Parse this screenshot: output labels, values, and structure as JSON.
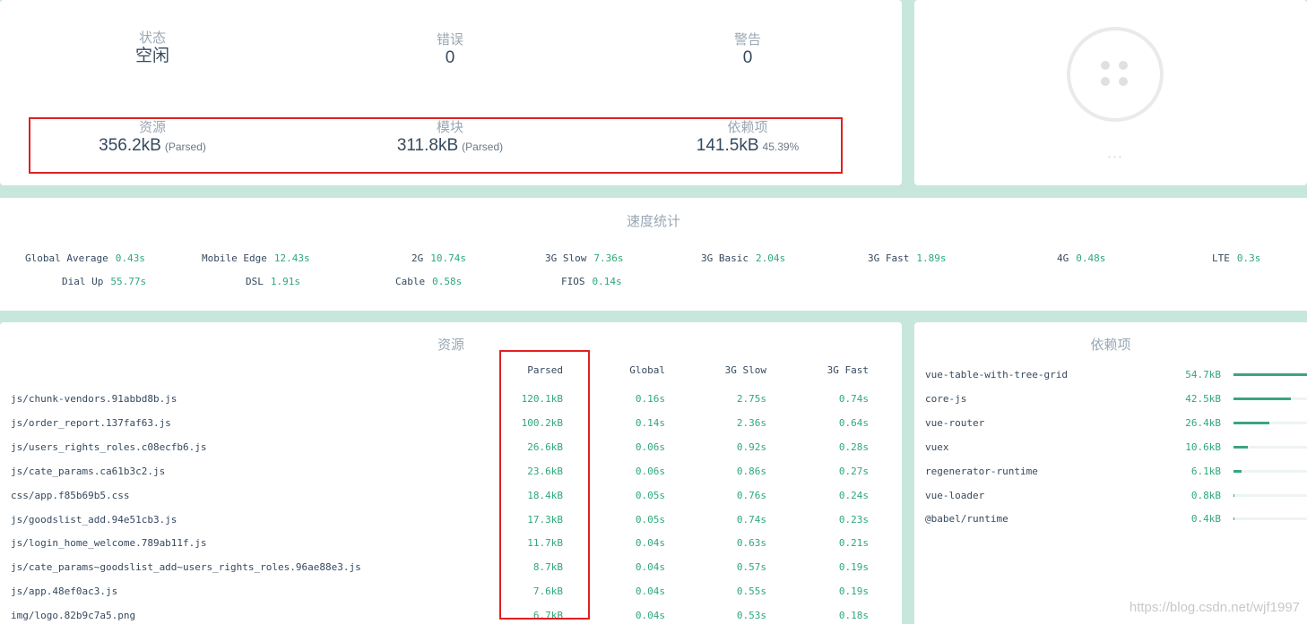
{
  "status": {
    "state": {
      "label": "状态",
      "value": "空闲"
    },
    "errors": {
      "label": "错误",
      "value": "0"
    },
    "warnings": {
      "label": "警告",
      "value": "0"
    },
    "assets": {
      "label": "资源",
      "value": "356.2kB",
      "sub": "(Parsed)"
    },
    "modules": {
      "label": "模块",
      "value": "311.8kB",
      "sub": "(Parsed)"
    },
    "dependencies": {
      "label": "依赖项",
      "value": "141.5kB",
      "sub": "45.39%"
    }
  },
  "logo": {
    "ellipsis": "···"
  },
  "speed": {
    "title": "速度统计",
    "items": [
      {
        "name": "Global Average",
        "value": "0.43s"
      },
      {
        "name": "Mobile Edge",
        "value": "12.43s"
      },
      {
        "name": "2G",
        "value": "10.74s"
      },
      {
        "name": "3G Slow",
        "value": "7.36s"
      },
      {
        "name": "3G Basic",
        "value": "2.04s"
      },
      {
        "name": "3G Fast",
        "value": "1.89s"
      },
      {
        "name": "4G",
        "value": "0.48s"
      },
      {
        "name": "LTE",
        "value": "0.3s"
      },
      {
        "name": "Dial Up",
        "value": "55.77s"
      },
      {
        "name": "DSL",
        "value": "1.91s"
      },
      {
        "name": "Cable",
        "value": "0.58s"
      },
      {
        "name": "FIOS",
        "value": "0.14s"
      }
    ]
  },
  "assets": {
    "title": "资源",
    "columns": [
      "Parsed",
      "Global",
      "3G Slow",
      "3G Fast"
    ],
    "rows": [
      {
        "name": "js/chunk-vendors.91abbd8b.js",
        "parsed": "120.1kB",
        "global": "0.16s",
        "slow": "2.75s",
        "fast": "0.74s"
      },
      {
        "name": "js/order_report.137faf63.js",
        "parsed": "100.2kB",
        "global": "0.14s",
        "slow": "2.36s",
        "fast": "0.64s"
      },
      {
        "name": "js/users_rights_roles.c08ecfb6.js",
        "parsed": "26.6kB",
        "global": "0.06s",
        "slow": "0.92s",
        "fast": "0.28s"
      },
      {
        "name": "js/cate_params.ca61b3c2.js",
        "parsed": "23.6kB",
        "global": "0.06s",
        "slow": "0.86s",
        "fast": "0.27s"
      },
      {
        "name": "css/app.f85b69b5.css",
        "parsed": "18.4kB",
        "global": "0.05s",
        "slow": "0.76s",
        "fast": "0.24s"
      },
      {
        "name": "js/goodslist_add.94e51cb3.js",
        "parsed": "17.3kB",
        "global": "0.05s",
        "slow": "0.74s",
        "fast": "0.23s"
      },
      {
        "name": "js/login_home_welcome.789ab11f.js",
        "parsed": "11.7kB",
        "global": "0.04s",
        "slow": "0.63s",
        "fast": "0.21s"
      },
      {
        "name": "js/cate_params~goodslist_add~users_rights_roles.96ae88e3.js",
        "parsed": "8.7kB",
        "global": "0.04s",
        "slow": "0.57s",
        "fast": "0.19s"
      },
      {
        "name": "js/app.48ef0ac3.js",
        "parsed": "7.6kB",
        "global": "0.04s",
        "slow": "0.55s",
        "fast": "0.19s"
      },
      {
        "name": "img/logo.82b9c7a5.png",
        "parsed": "6.7kB",
        "global": "0.04s",
        "slow": "0.53s",
        "fast": "0.18s"
      }
    ]
  },
  "dependencies": {
    "title": "依赖项",
    "items": [
      {
        "name": "vue-table-with-tree-grid",
        "size": "54.7kB",
        "percent": 100
      },
      {
        "name": "core-js",
        "size": "42.5kB",
        "percent": 77.7
      },
      {
        "name": "vue-router",
        "size": "26.4kB",
        "percent": 48.3
      },
      {
        "name": "vuex",
        "size": "10.6kB",
        "percent": 19.4
      },
      {
        "name": "regenerator-runtime",
        "size": "6.1kB",
        "percent": 11.2
      },
      {
        "name": "vue-loader",
        "size": "0.8kB",
        "percent": 1.5
      },
      {
        "name": "@babel/runtime",
        "size": "0.4kB",
        "percent": 0.7
      }
    ]
  },
  "watermark": "https://blog.csdn.net/wjf1997"
}
